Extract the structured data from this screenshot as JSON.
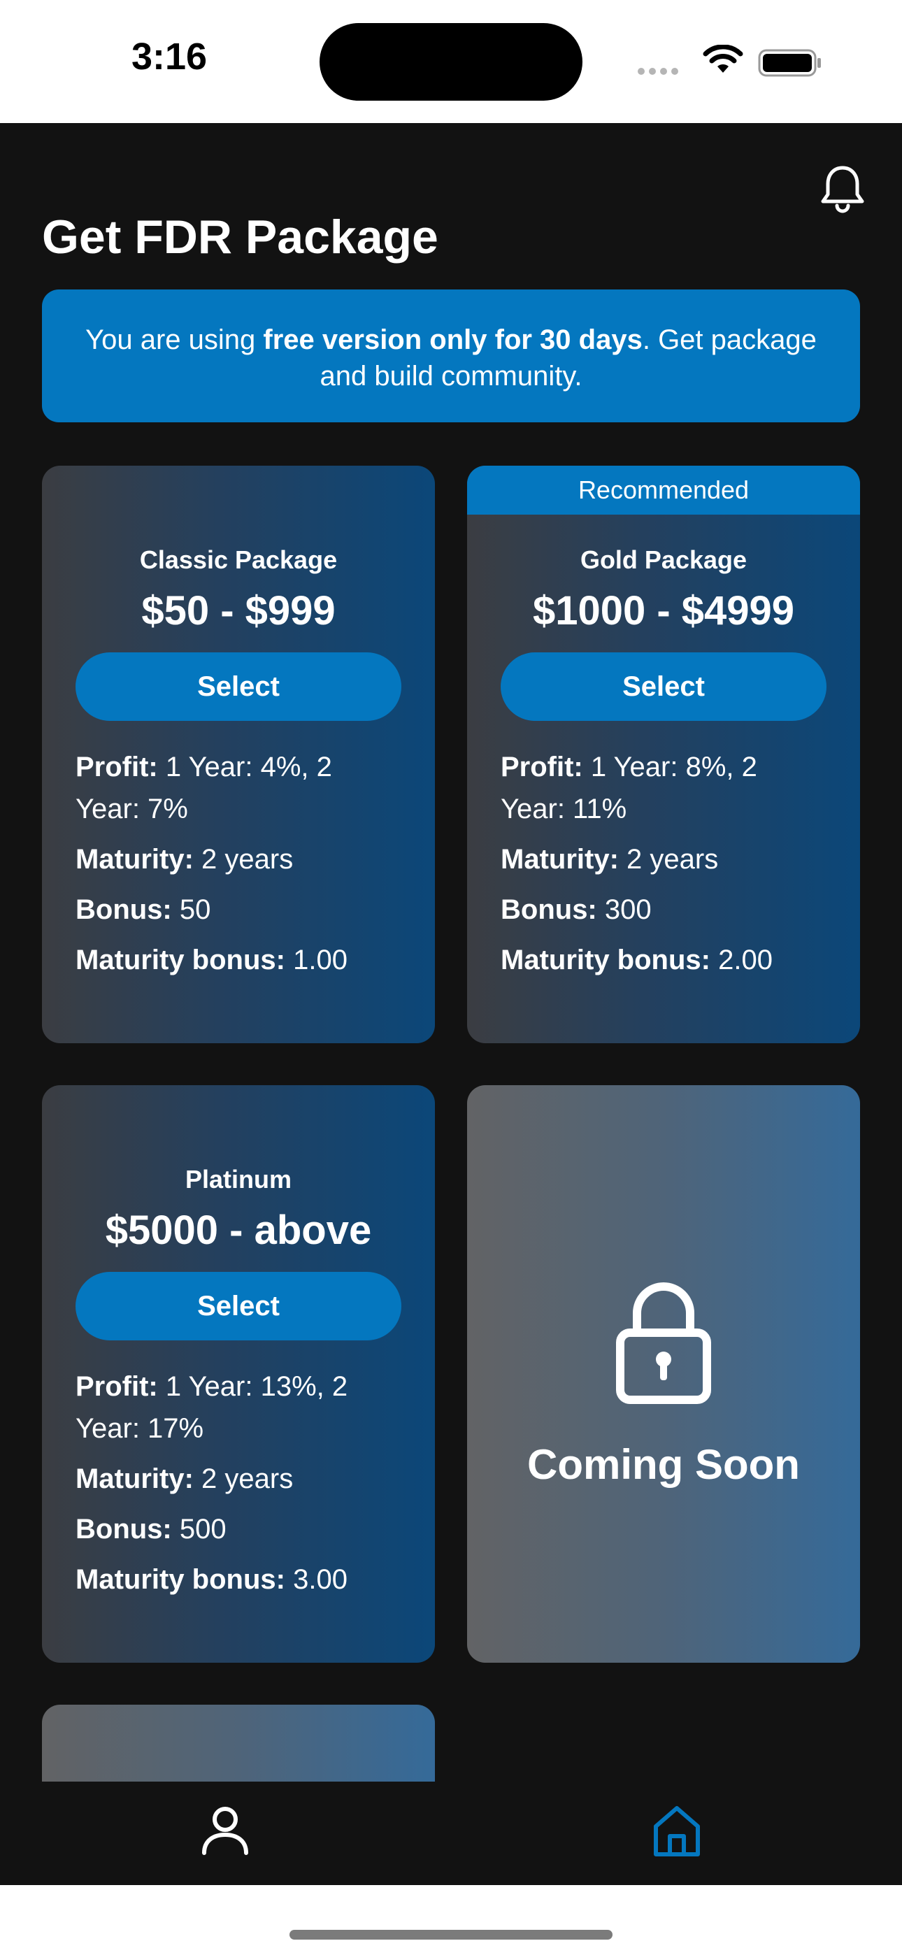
{
  "status_bar": {
    "time": "3:16"
  },
  "header": {
    "title": "Get FDR Package"
  },
  "banner": {
    "text_before": "You are using ",
    "text_bold": "free version only for 30 days",
    "text_after": ". Get package and build community."
  },
  "packages": [
    {
      "name": "Classic Package",
      "price": "$50 - $999",
      "select_label": "Select",
      "profit_label": "Profit:",
      "profit_value": "1 Year: 4%, 2 Year: 7%",
      "maturity_label": "Maturity:",
      "maturity_value": "2 years",
      "bonus_label": "Bonus:",
      "bonus_value": "50",
      "maturity_bonus_label": "Maturity bonus:",
      "maturity_bonus_value": "1.00"
    },
    {
      "badge": "Recommended",
      "name": "Gold Package",
      "price": "$1000 - $4999",
      "select_label": "Select",
      "profit_label": "Profit:",
      "profit_value": "1 Year: 8%, 2 Year: 11%",
      "maturity_label": "Maturity:",
      "maturity_value": "2 years",
      "bonus_label": "Bonus:",
      "bonus_value": "300",
      "maturity_bonus_label": "Maturity bonus:",
      "maturity_bonus_value": "2.00"
    },
    {
      "name": "Platinum",
      "price": "$5000 - above",
      "select_label": "Select",
      "profit_label": "Profit:",
      "profit_value": "1 Year: 13%, 2 Year: 17%",
      "maturity_label": "Maturity:",
      "maturity_value": "2 years",
      "bonus_label": "Bonus:",
      "bonus_value": "500",
      "maturity_bonus_label": "Maturity bonus:",
      "maturity_bonus_value": "3.00"
    }
  ],
  "locked_card": {
    "label": "Coming Soon",
    "icon": "lock-icon"
  },
  "tab_bar": {
    "items": [
      {
        "icon": "person-icon"
      },
      {
        "icon": "home-icon",
        "active": true
      }
    ]
  },
  "colors": {
    "accent": "#0477bf",
    "background": "#121212"
  }
}
